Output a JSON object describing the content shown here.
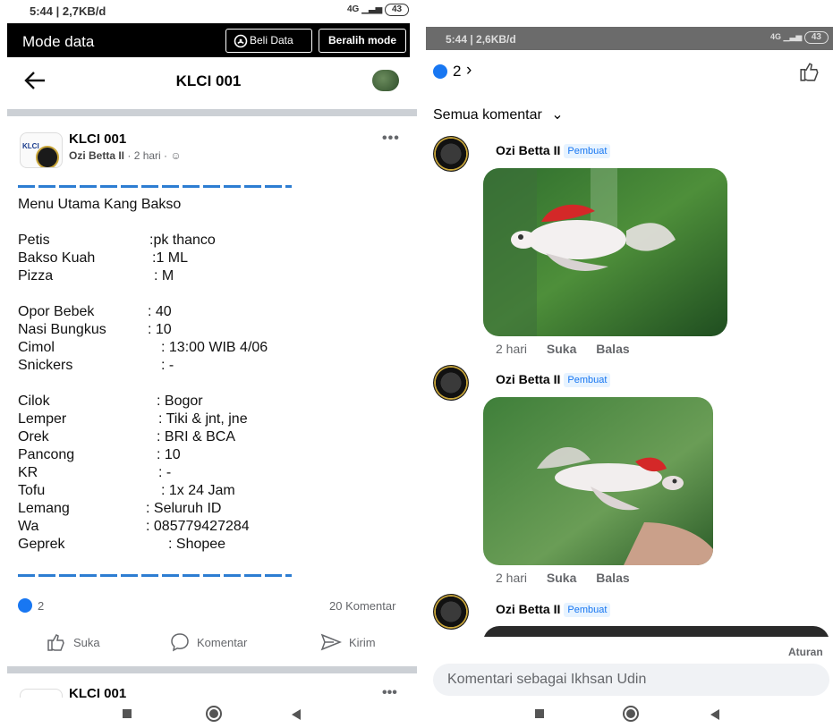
{
  "left": {
    "status": {
      "left_text": "5:44 | 2,7KB/d",
      "signal": "4G",
      "battery": "43"
    },
    "modebar": {
      "title": "Mode data",
      "beli_label": "Beli Data",
      "beralih_label": "Beralih mode"
    },
    "header": {
      "title": "KLCI 001"
    },
    "post": {
      "avatar_text": "KLCI",
      "group_name": "KLCI 001",
      "author": "Ozi Betta II",
      "time": "· 2 hari ·",
      "heading": "Menu Utama Kang Bakso",
      "rows": [
        {
          "k": "Petis",
          "v": ":pk thanco"
        },
        {
          "k": "Bakso Kuah",
          "v": ":1 ML"
        },
        {
          "k": "Pizza",
          "v": ": M"
        },
        {
          "k": "Opor Bebek",
          "v": ": 40"
        },
        {
          "k": "Nasi Bungkus",
          "v": ": 10"
        },
        {
          "k": "Cimol",
          "v": ": 13:00 WIB 4/06"
        },
        {
          "k": "Snickers",
          "v": ": -"
        },
        {
          "k": "Cilok",
          "v": ":  Bogor"
        },
        {
          "k": "Lemper",
          "v": ":  Tiki & jnt, jne"
        },
        {
          "k": "Orek",
          "v": ":  BRI & BCA"
        },
        {
          "k": "Pancong",
          "v": ":  10"
        },
        {
          "k": "KR",
          "v": ": -"
        },
        {
          "k": "Tofu",
          "v": ":  1x 24 Jam"
        },
        {
          "k": "Lemang",
          "v": ":  Seluruh ID"
        },
        {
          "k": "Wa",
          "v": ":  085779427284"
        },
        {
          "k": "Geprek",
          "v": ": Shopee"
        }
      ],
      "like_count": "2",
      "comment_count": "20 Komentar",
      "actions": {
        "like": "Suka",
        "comment": "Komentar",
        "send": "Kirim"
      }
    },
    "next_post": {
      "name": "KLCI 001"
    }
  },
  "right": {
    "status": {
      "left_text": "5:44 | 2,6KB/d",
      "signal": "4G",
      "battery": "43"
    },
    "like_count": "2",
    "sort_label": "Semua komentar",
    "comments": [
      {
        "author": "Ozi Betta II",
        "badge": "Pembuat",
        "time": "2 hari",
        "like": "Suka",
        "reply": "Balas"
      },
      {
        "author": "Ozi Betta II",
        "badge": "Pembuat",
        "time": "2 hari",
        "like": "Suka",
        "reply": "Balas"
      },
      {
        "author": "Ozi Betta II",
        "badge": "Pembuat"
      }
    ],
    "rules_label": "Aturan",
    "input_placeholder": "Komentari sebagai Ikhsan Udin"
  },
  "colors": {
    "accent": "#1877f2",
    "dash": "#2d7dd2",
    "modebar": "#000000",
    "separator": "#ccd0d5"
  },
  "icons": [
    "back-arrow-icon",
    "beli-data-icon",
    "thumbs-up-icon",
    "comment-icon",
    "send-icon",
    "more-icon",
    "chevron-down-icon",
    "chevron-right-icon"
  ]
}
